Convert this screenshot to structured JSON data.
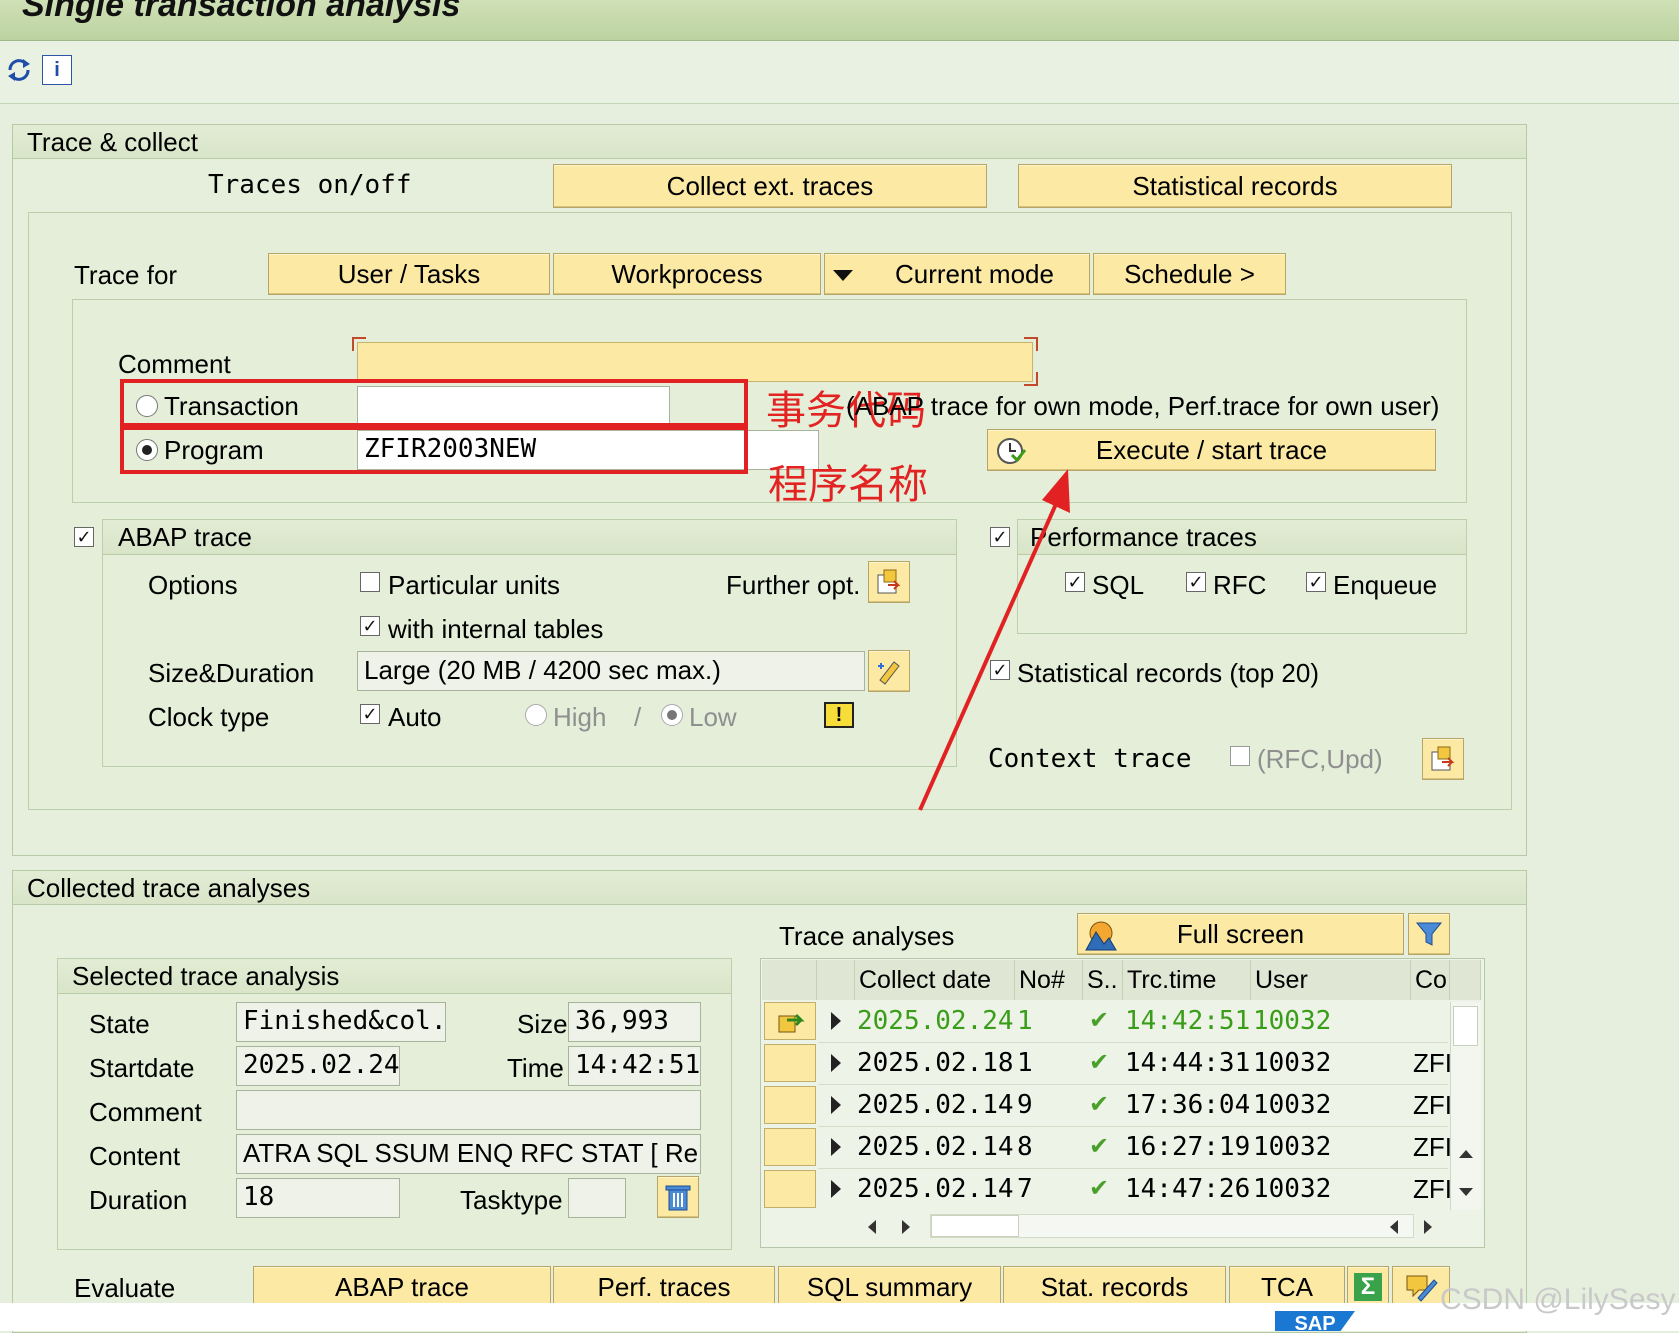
{
  "window": {
    "title": "Single transaction analysis"
  },
  "toolbar": {
    "icons": [
      "refresh-icon",
      "info-icon"
    ]
  },
  "trace_collect": {
    "header": "Trace & collect",
    "traces_on_off": "Traces on/off",
    "collect_ext_traces": "Collect ext. traces",
    "statistical_records": "Statistical records",
    "trace_for_label": "Trace for",
    "user_tasks": "User / Tasks",
    "workprocess": "Workprocess",
    "current_mode": "Current mode",
    "schedule": "Schedule >",
    "comment_label": "Comment",
    "comment_value": "",
    "transaction_label": "Transaction",
    "transaction_value": "",
    "program_label": "Program",
    "program_value": "ZFIR2003NEW",
    "hint": "(ABAP trace for own mode, Perf.trace for own user)",
    "execute": "Execute / start trace",
    "selected_option": "Program"
  },
  "annotations": {
    "transaction_cn": "事务代码",
    "program_cn": "程序名称"
  },
  "abap_trace": {
    "header": "ABAP trace",
    "checked": true,
    "options_label": "Options",
    "particular_units": "Particular units",
    "particular_units_checked": false,
    "further_opt": "Further opt.",
    "with_internal_tables": "with internal tables",
    "with_internal_tables_checked": true,
    "size_duration_label": "Size&Duration",
    "size_duration_value": "Large (20 MB / 4200 sec max.)",
    "clock_type_label": "Clock type",
    "auto": "Auto",
    "auto_checked": true,
    "high": "High",
    "slash": "/",
    "low": "Low"
  },
  "performance_traces": {
    "header": "Performance traces",
    "checked": true,
    "sql": "SQL",
    "rfc": "RFC",
    "enqueue": "Enqueue",
    "statistical_records_top20": "Statistical records (top 20)",
    "context_trace": "Context trace",
    "rfc_upd": "(RFC,Upd)"
  },
  "collected": {
    "header": "Collected trace analyses",
    "selected_header": "Selected trace analysis",
    "state_label": "State",
    "state_value": "Finished&col...",
    "size_label": "Size",
    "size_value": "36,993",
    "startdate_label": "Startdate",
    "startdate_value": "2025.02.24",
    "time_label": "Time",
    "time_value": "14:42:51",
    "comment_label": "Comment",
    "comment_value": "",
    "content_label": "Content",
    "content_value": "ATRA SQL SSUM ENQ RFC STAT [ Re...",
    "duration_label": "Duration",
    "duration_value": "18",
    "tasktype_label": "Tasktype",
    "tasktype_value": ""
  },
  "trace_analyses": {
    "label": "Trace analyses",
    "full_screen": "Full screen",
    "columns": [
      "Collect date",
      "No#",
      "S..",
      "Trc.time",
      "User",
      "Co"
    ],
    "rows": [
      {
        "date": "2025.02.24",
        "no": "1",
        "time": "14:42:51",
        "user": "10032",
        "co": ""
      },
      {
        "date": "2025.02.18",
        "no": "1",
        "time": "14:44:31",
        "user": "10032",
        "co": "ZFI"
      },
      {
        "date": "2025.02.14",
        "no": "9",
        "time": "17:36:04",
        "user": "10032",
        "co": "ZFI"
      },
      {
        "date": "2025.02.14",
        "no": "8",
        "time": "16:27:19",
        "user": "10032",
        "co": "ZFI"
      },
      {
        "date": "2025.02.14",
        "no": "7",
        "time": "14:47:26",
        "user": "10032",
        "co": "ZFI"
      }
    ]
  },
  "evaluate": {
    "label": "Evaluate",
    "abap_trace": "ABAP trace",
    "perf_traces": "Perf. traces",
    "sql_summary": "SQL summary",
    "stat_records": "Stat. records",
    "tca": "TCA"
  },
  "watermark": "CSDN @LilySesy",
  "sap_logo": "SAP"
}
